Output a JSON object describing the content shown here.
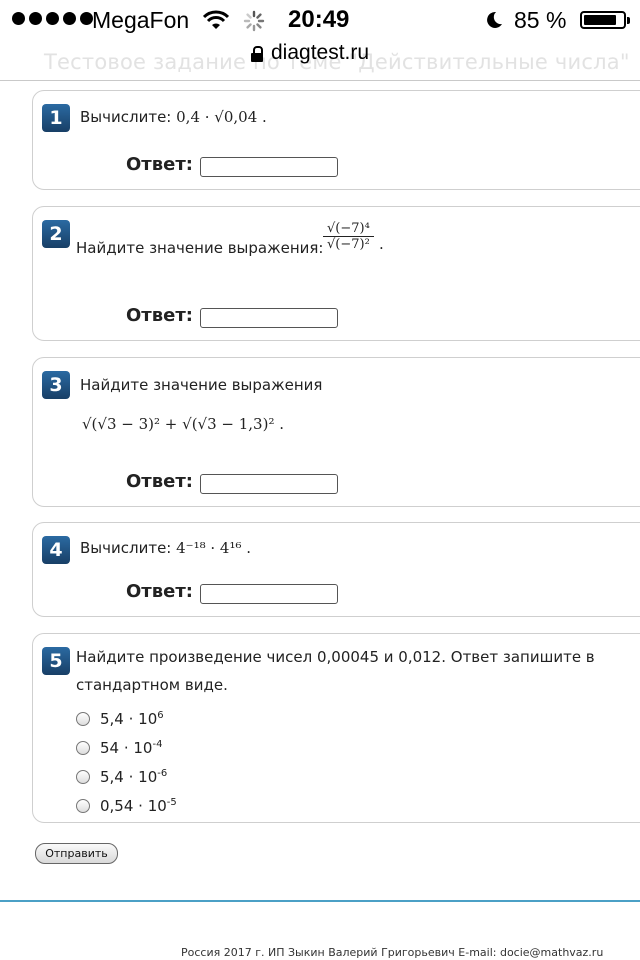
{
  "status_bar": {
    "carrier": "MegaFon",
    "time": "20:49",
    "battery": "85 %",
    "battery_level": 0.85
  },
  "browser": {
    "url": "diagtest.ru",
    "page_title_ghost": "Тестовое задание по теме \"Действительные числа\""
  },
  "questions": [
    {
      "number": "1",
      "prompt": "Вычислите:",
      "expr": "0,4 · √0,04 .",
      "answer_label": "Ответ:"
    },
    {
      "number": "2",
      "prompt": "Найдите значение выражения:",
      "expr_num": "√(−7)⁴",
      "expr_den": "√(−7)²",
      "answer_label": "Ответ:"
    },
    {
      "number": "3",
      "prompt": "Найдите значение выражения",
      "expr": "√(√3 − 3)² + √(√3 − 1,3)² .",
      "answer_label": "Ответ:"
    },
    {
      "number": "4",
      "prompt": "Вычислите:",
      "expr": "4⁻¹⁸ · 4¹⁶ .",
      "answer_label": "Ответ:"
    },
    {
      "number": "5",
      "prompt_line1": "Найдите произведение чисел 0,00045  и 0,012.  Ответ запишите в",
      "prompt_line2": "стандартном виде.",
      "options": [
        {
          "base": "5,4  ·  10",
          "exp": "6"
        },
        {
          "base": "54  ·  10",
          "exp": "-4"
        },
        {
          "base": "5,4  ·  10",
          "exp": "-6"
        },
        {
          "base": "0,54  ·  10",
          "exp": "-5"
        }
      ]
    }
  ],
  "submit_label": "Отправить",
  "footer": "Россия 2017 г. ИП Зыкин Валерий Григорьевич E-mail: docie@mathvaz.ru"
}
